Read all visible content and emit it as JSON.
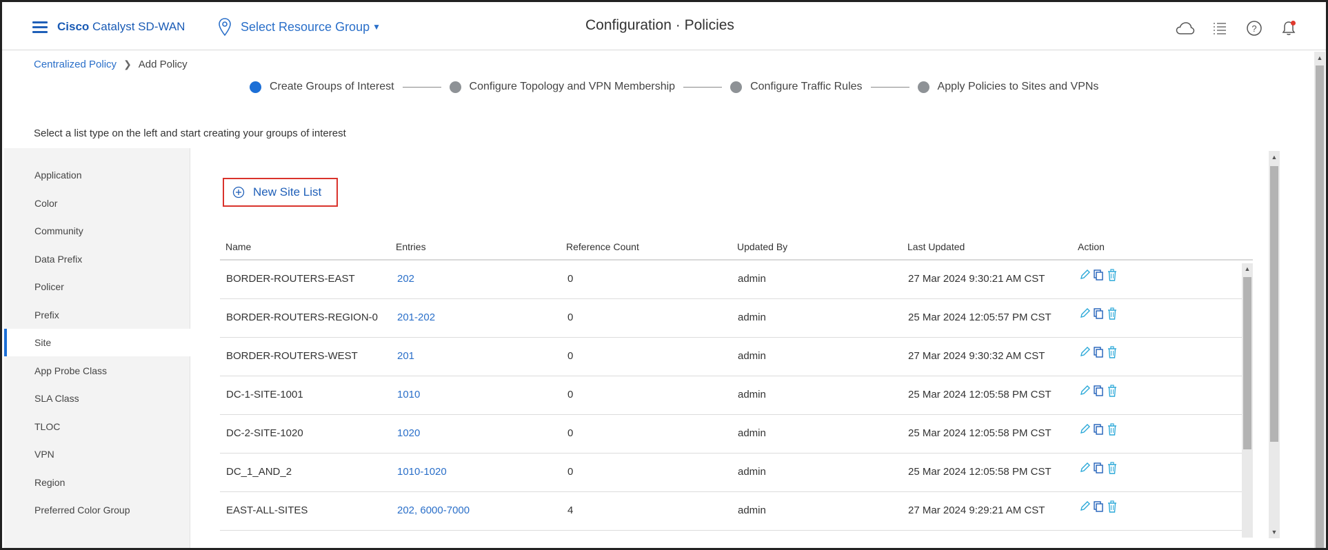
{
  "header": {
    "brand_bold": "Cisco",
    "brand_rest": " Catalyst SD-WAN",
    "resource_group": "Select Resource Group",
    "title": "Configuration · Policies",
    "icons": [
      "menu-icon",
      "location-pin-icon",
      "cloud-icon",
      "list-icon",
      "help-icon",
      "bell-icon"
    ]
  },
  "breadcrumb": {
    "parent": "Centralized Policy",
    "current": "Add Policy"
  },
  "stepper": {
    "steps": [
      {
        "label": "Create Groups of Interest",
        "active": true
      },
      {
        "label": "Configure Topology and VPN Membership",
        "active": false
      },
      {
        "label": "Configure Traffic Rules",
        "active": false
      },
      {
        "label": "Apply Policies to Sites and VPNs",
        "active": false
      }
    ]
  },
  "instruction": "Select a list type on the left and start creating your groups of interest",
  "sidebar": {
    "items": [
      {
        "label": "Application"
      },
      {
        "label": "Color"
      },
      {
        "label": "Community"
      },
      {
        "label": "Data Prefix"
      },
      {
        "label": "Policer"
      },
      {
        "label": "Prefix"
      },
      {
        "label": "Site",
        "active": true
      },
      {
        "label": "App Probe Class"
      },
      {
        "label": "SLA Class"
      },
      {
        "label": "TLOC"
      },
      {
        "label": "VPN"
      },
      {
        "label": "Region"
      },
      {
        "label": "Preferred Color Group"
      }
    ]
  },
  "new_list_button": "New Site List",
  "table": {
    "headers": [
      "Name",
      "Entries",
      "Reference Count",
      "Updated By",
      "Last Updated",
      "Action"
    ],
    "rows": [
      {
        "name": "BORDER-ROUTERS-EAST",
        "entries": "202",
        "ref": "0",
        "by": "admin",
        "updated": "27 Mar 2024 9:30:21 AM CST"
      },
      {
        "name": "BORDER-ROUTERS-REGION-0",
        "entries": "201-202",
        "ref": "0",
        "by": "admin",
        "updated": "25 Mar 2024 12:05:57 PM CST"
      },
      {
        "name": "BORDER-ROUTERS-WEST",
        "entries": "201",
        "ref": "0",
        "by": "admin",
        "updated": "27 Mar 2024 9:30:32 AM CST"
      },
      {
        "name": "DC-1-SITE-1001",
        "entries": "1010",
        "ref": "0",
        "by": "admin",
        "updated": "25 Mar 2024 12:05:58 PM CST"
      },
      {
        "name": "DC-2-SITE-1020",
        "entries": "1020",
        "ref": "0",
        "by": "admin",
        "updated": "25 Mar 2024 12:05:58 PM CST"
      },
      {
        "name": "DC_1_AND_2",
        "entries": "1010-1020",
        "ref": "0",
        "by": "admin",
        "updated": "25 Mar 2024 12:05:58 PM CST"
      },
      {
        "name": "EAST-ALL-SITES",
        "entries": "202, 6000-7000",
        "ref": "4",
        "by": "admin",
        "updated": "27 Mar 2024 9:29:21 AM CST"
      }
    ]
  },
  "colors": {
    "accent": "#1c6fd6",
    "link": "#2a6fc9",
    "highlight_border": "#d9322b",
    "inactive_step": "#8e9296",
    "action_icon": "#2aa8d8"
  }
}
